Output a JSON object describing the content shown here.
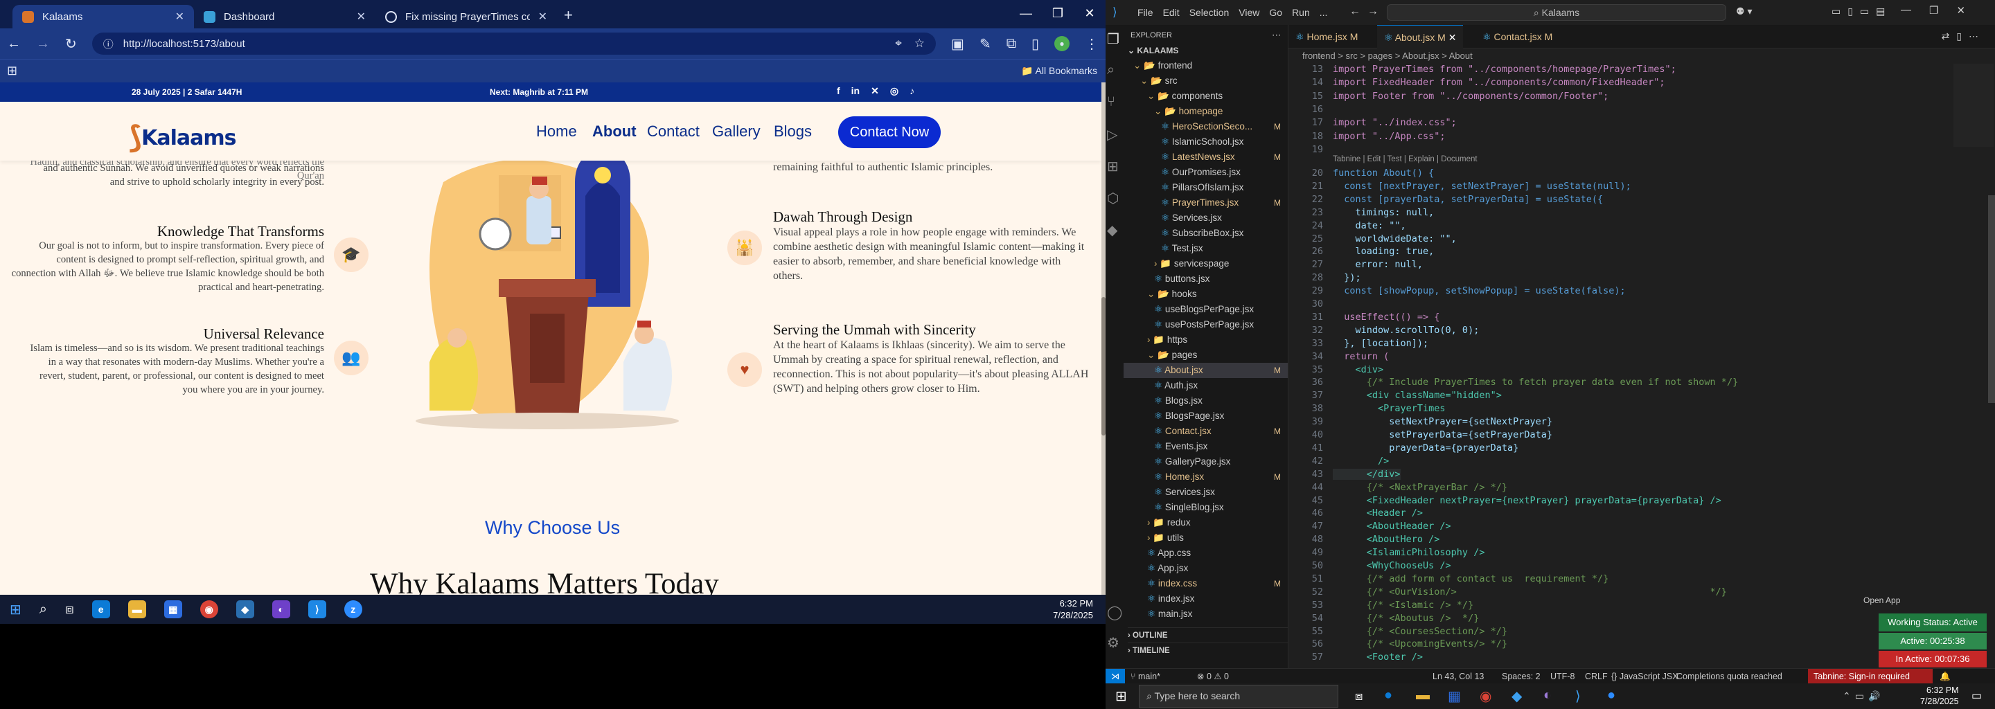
{
  "browser": {
    "tabs": [
      {
        "title": "Kalaams",
        "active": true
      },
      {
        "title": "Dashboard",
        "active": false
      },
      {
        "title": "Fix missing PrayerTimes comp",
        "active": false
      }
    ],
    "url": "http://localhost:5173/about",
    "all_bookmarks": "All Bookmarks"
  },
  "site": {
    "date": "28 July 2025 | 2 Safar 1447H",
    "next_prayer": "Next: Maghrib at 7:11 PM",
    "logo": "Kalaams",
    "nav": [
      "Home",
      "About",
      "Contact",
      "Gallery",
      "Blogs"
    ],
    "cta": "Contact Now",
    "left_top_text": "and authentic Sunnah. We avoid unverified quotes or weak narrations and strive to uphold scholarly integrity in every post.",
    "left_top_partial": "Hadith, and classical scholarship, and ensure that every word reflects the Qur'an",
    "items_left": [
      {
        "title": "Knowledge That Transforms",
        "text": "Our goal is not to inform, but to inspire transformation. Every piece of content is designed to prompt self-reflection, spiritual growth, and connection with Allah ﷻ. We believe true Islamic knowledge should be both practical and heart-penetrating."
      },
      {
        "title": "Universal Relevance",
        "text": "Islam is timeless—and so is its wisdom. We present traditional teachings in a way that resonates with modern-day Muslims. Whether you're a revert, student, parent, or professional, our content is designed to meet you where you are in your journey."
      }
    ],
    "right_top_text": "remaining faithful to authentic Islamic principles.",
    "items_right": [
      {
        "title": "Dawah Through Design",
        "text": "Visual appeal plays a role in how people engage with reminders. We combine aesthetic design with meaningful Islamic content—making it easier to absorb, remember, and share beneficial knowledge with others."
      },
      {
        "title": "Serving the Ummah with Sincerity",
        "text": "At the heart of Kalaams is Ikhlaas (sincerity). We aim to serve the Ummah by creating a space for spiritual renewal, reflection, and reconnection. This is not about popularity—it's about pleasing ALLAH (SWT) and helping others grow closer to Him."
      }
    ],
    "why_label": "Why Choose Us",
    "why_heading": "Why Kalaams Matters Today"
  },
  "taskbar_left": {
    "time": "6:32 PM",
    "date": "7/28/2025"
  },
  "vscode": {
    "menu": [
      "File",
      "Edit",
      "Selection",
      "View",
      "Go",
      "Run",
      "..."
    ],
    "search": "Kalaams",
    "explorer_title": "EXPLORER",
    "root": "KALAAMS",
    "tree": [
      {
        "name": "frontend",
        "depth": 1,
        "folder": true,
        "open": true
      },
      {
        "name": "src",
        "depth": 2,
        "folder": true,
        "open": true
      },
      {
        "name": "components",
        "depth": 3,
        "folder": true,
        "open": true
      },
      {
        "name": "homepage",
        "depth": 4,
        "folder": true,
        "open": true,
        "color": "#e2c08d"
      },
      {
        "name": "HeroSectionSeco...",
        "depth": 5,
        "mod": "M",
        "color": "#e2c08d"
      },
      {
        "name": "IslamicSchool.jsx",
        "depth": 5
      },
      {
        "name": "LatestNews.jsx",
        "depth": 5,
        "mod": "M",
        "color": "#e2c08d"
      },
      {
        "name": "OurPromises.jsx",
        "depth": 5
      },
      {
        "name": "PillarsOfIslam.jsx",
        "depth": 5
      },
      {
        "name": "PrayerTimes.jsx",
        "depth": 5,
        "mod": "M",
        "color": "#e2c08d"
      },
      {
        "name": "Services.jsx",
        "depth": 5
      },
      {
        "name": "SubscribeBox.jsx",
        "depth": 5
      },
      {
        "name": "Test.jsx",
        "depth": 5
      },
      {
        "name": "servicespage",
        "depth": 4,
        "folder": true
      },
      {
        "name": "buttons.jsx",
        "depth": 4
      },
      {
        "name": "hooks",
        "depth": 3,
        "folder": true,
        "open": true
      },
      {
        "name": "useBlogsPerPage.jsx",
        "depth": 4
      },
      {
        "name": "usePostsPerPage.jsx",
        "depth": 4
      },
      {
        "name": "https",
        "depth": 3,
        "folder": true
      },
      {
        "name": "pages",
        "depth": 3,
        "folder": true,
        "open": true
      },
      {
        "name": "About.jsx",
        "depth": 4,
        "mod": "M",
        "color": "#e2c08d",
        "sel": true
      },
      {
        "name": "Auth.jsx",
        "depth": 4
      },
      {
        "name": "Blogs.jsx",
        "depth": 4
      },
      {
        "name": "BlogsPage.jsx",
        "depth": 4
      },
      {
        "name": "Contact.jsx",
        "depth": 4,
        "mod": "M",
        "color": "#e2c08d"
      },
      {
        "name": "Events.jsx",
        "depth": 4
      },
      {
        "name": "GalleryPage.jsx",
        "depth": 4
      },
      {
        "name": "Home.jsx",
        "depth": 4,
        "mod": "M",
        "color": "#e2c08d"
      },
      {
        "name": "Services.jsx",
        "depth": 4
      },
      {
        "name": "SingleBlog.jsx",
        "depth": 4
      },
      {
        "name": "redux",
        "depth": 3,
        "folder": true
      },
      {
        "name": "utils",
        "depth": 3,
        "folder": true
      },
      {
        "name": "App.css",
        "depth": 3
      },
      {
        "name": "App.jsx",
        "depth": 3
      },
      {
        "name": "index.css",
        "depth": 3,
        "mod": "M",
        "color": "#e2c08d"
      },
      {
        "name": "index.jsx",
        "depth": 3
      },
      {
        "name": "main.jsx",
        "depth": 3
      }
    ],
    "outline": "OUTLINE",
    "timeline": "TIMELINE",
    "tabs": [
      {
        "name": "Home.jsx",
        "mod": "M"
      },
      {
        "name": "About.jsx",
        "mod": "M",
        "active": true
      },
      {
        "name": "Contact.jsx",
        "mod": "M"
      }
    ],
    "breadcrumb": "frontend > src > pages > About.jsx > About",
    "codelens": "Tabnine | Edit | Test | Explain | Document",
    "code": [
      {
        "n": "13",
        "t": "import PrayerTimes from \"../components/homepage/PrayerTimes\";"
      },
      {
        "n": "14",
        "t": "import FixedHeader from \"../components/common/FixedHeader\";"
      },
      {
        "n": "15",
        "t": "import Footer from \"../components/common/Footer\";"
      },
      {
        "n": "16",
        "t": ""
      },
      {
        "n": "17",
        "t": "import \"../index.css\";"
      },
      {
        "n": "18",
        "t": "import \"../App.css\";"
      },
      {
        "n": "19",
        "t": ""
      },
      {
        "n": "20",
        "t": "function About() {"
      },
      {
        "n": "21",
        "t": "  const [nextPrayer, setNextPrayer] = useState(null);"
      },
      {
        "n": "22",
        "t": "  const [prayerData, setPrayerData] = useState({"
      },
      {
        "n": "23",
        "t": "    timings: null,"
      },
      {
        "n": "24",
        "t": "    date: \"\","
      },
      {
        "n": "25",
        "t": "    worldwideDate: \"\","
      },
      {
        "n": "26",
        "t": "    loading: true,"
      },
      {
        "n": "27",
        "t": "    error: null,"
      },
      {
        "n": "28",
        "t": "  });"
      },
      {
        "n": "29",
        "t": "  const [showPopup, setShowPopup] = useState(false);"
      },
      {
        "n": "30",
        "t": ""
      },
      {
        "n": "31",
        "t": "  useEffect(() => {"
      },
      {
        "n": "32",
        "t": "    window.scrollTo(0, 0);"
      },
      {
        "n": "33",
        "t": "  }, [location]);"
      },
      {
        "n": "34",
        "t": "  return ("
      },
      {
        "n": "35",
        "t": "    <div>"
      },
      {
        "n": "36",
        "t": "      {/* Include PrayerTimes to fetch prayer data even if not shown */}"
      },
      {
        "n": "37",
        "t": "      <div className=\"hidden\">"
      },
      {
        "n": "38",
        "t": "        <PrayerTimes"
      },
      {
        "n": "39",
        "t": "          setNextPrayer={setNextPrayer}"
      },
      {
        "n": "40",
        "t": "          setPrayerData={setPrayerData}"
      },
      {
        "n": "41",
        "t": "          prayerData={prayerData}"
      },
      {
        "n": "42",
        "t": "        />"
      },
      {
        "n": "43",
        "t": "      </div>"
      },
      {
        "n": "44",
        "t": "      {/* <NextPrayerBar /> */}"
      },
      {
        "n": "45",
        "t": "      <FixedHeader nextPrayer={nextPrayer} prayerData={prayerData} />"
      },
      {
        "n": "46",
        "t": "      <Header />"
      },
      {
        "n": "47",
        "t": "      <AboutHeader />"
      },
      {
        "n": "48",
        "t": "      <AboutHero />"
      },
      {
        "n": "49",
        "t": "      <IslamicPhilosophy />"
      },
      {
        "n": "50",
        "t": "      <WhyChooseUs />"
      },
      {
        "n": "51",
        "t": "      {/* add form of contact us  requirement */}"
      },
      {
        "n": "52",
        "t": "      {/* <OurVision/>                                             */}"
      },
      {
        "n": "53",
        "t": "      {/* <Islamic /> */}"
      },
      {
        "n": "54",
        "t": "      {/* <Aboutus />  */}"
      },
      {
        "n": "55",
        "t": "      {/* <CoursesSection/> */}"
      },
      {
        "n": "56",
        "t": "      {/* <UpcomingEvents/> */}"
      },
      {
        "n": "57",
        "t": "      <Footer />"
      }
    ],
    "status": {
      "branch": "main*",
      "problems": "⊗ 0 ⚠ 0",
      "pos": "Ln 43, Col 13",
      "spaces": "Spaces: 2",
      "enc": "UTF-8",
      "eol": "CRLF",
      "lang": "JavaScript JSX",
      "quota": "Completions quota reached",
      "tabnine": "Tabnine: Sign-in required"
    },
    "open_app": "Open App",
    "working_status": "Working Status: Active",
    "active_time": "Active: 00:25:38",
    "inactive_time": "In Active: 00:07:36"
  },
  "taskbar_right": {
    "search_placeholder": "Type here to search",
    "time": "6:32 PM",
    "date": "7/28/2025"
  }
}
